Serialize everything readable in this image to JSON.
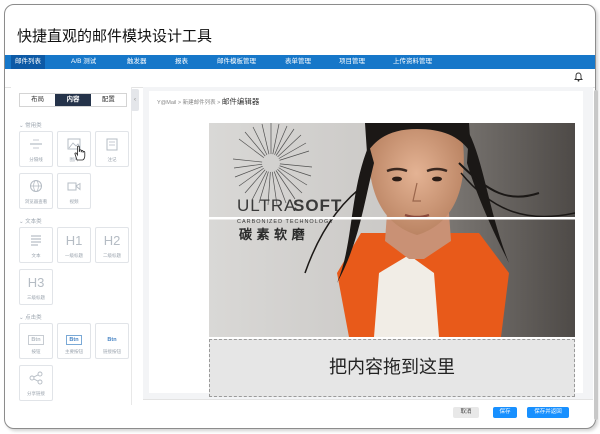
{
  "title": "快捷直观的邮件模块设计工具",
  "nav": [
    "邮件列表",
    "A/B 测试",
    "触发器",
    "报表",
    "邮件模板管理",
    "表单管理",
    "项目管理",
    "上传资料管理"
  ],
  "left_panel": {
    "tabs": [
      "布局",
      "内容",
      "配置"
    ],
    "active_tab": "内容",
    "sections": {
      "common": "常用类",
      "text": "文本类",
      "click": "点击类"
    },
    "tools": {
      "divider": {
        "label": "分隔线",
        "icon": "divider-icon"
      },
      "image": {
        "label": "图片",
        "icon": "image-icon"
      },
      "note": {
        "label": "注记",
        "icon": "note-icon"
      },
      "browser": {
        "label": "浏览器查看",
        "icon": "globe-icon"
      },
      "video": {
        "label": "视频",
        "icon": "video-icon"
      },
      "text": {
        "label": "文本",
        "icon": "text-block-icon"
      },
      "h1": {
        "glyph": "H1",
        "label": "一级标题"
      },
      "h2": {
        "glyph": "H2",
        "label": "二级标题"
      },
      "h3": {
        "glyph": "H3",
        "label": "三级标题"
      },
      "btn1": {
        "glyph": "Btn",
        "label": "按钮"
      },
      "btn2": {
        "glyph": "Btn",
        "label": "主要按钮"
      },
      "btn3": {
        "glyph": "Btn",
        "label": "链接按钮"
      },
      "share": {
        "label": "分享链接",
        "icon": "share-icon"
      }
    }
  },
  "breadcrumb": {
    "path": "Y@Mail > 新建邮件列表 >",
    "current": "邮件编辑器"
  },
  "canvas": {
    "ad_brand_main": "ULTRA",
    "ad_brand_bold": "SOFT",
    "ad_tagline": "CARBONIZED TECHNOLOGY",
    "ad_chinese": "碳 素 软 磨",
    "drop_zone": "把内容拖到这里"
  },
  "footer": {
    "cancel": "取消",
    "save": "保存",
    "save_return": "保存并返回"
  },
  "colors": {
    "nav": "#1677c9",
    "nav_active": "#0d5aa6",
    "tab_active": "#25334a",
    "primary": "#1890ff",
    "jacket": "#e85a1a"
  }
}
